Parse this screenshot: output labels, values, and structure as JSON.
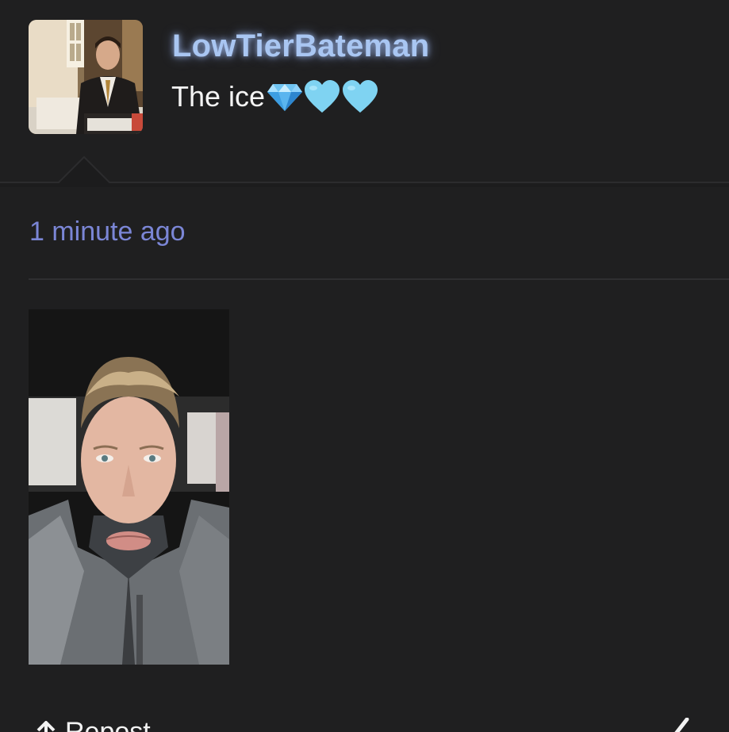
{
  "post": {
    "username": "LowTierBateman",
    "text": "The ice",
    "emojis": [
      "gem-icon",
      "light-blue-heart-icon",
      "light-blue-heart-icon"
    ],
    "timestamp": "1 minute ago"
  },
  "actions": {
    "repost_label": "Repost"
  },
  "colors": {
    "background": "#1f1f20",
    "username": "#a9c6f2",
    "timestamp": "#7b86d6",
    "text": "#f4f4f4",
    "heart": "#7fd3f2"
  }
}
